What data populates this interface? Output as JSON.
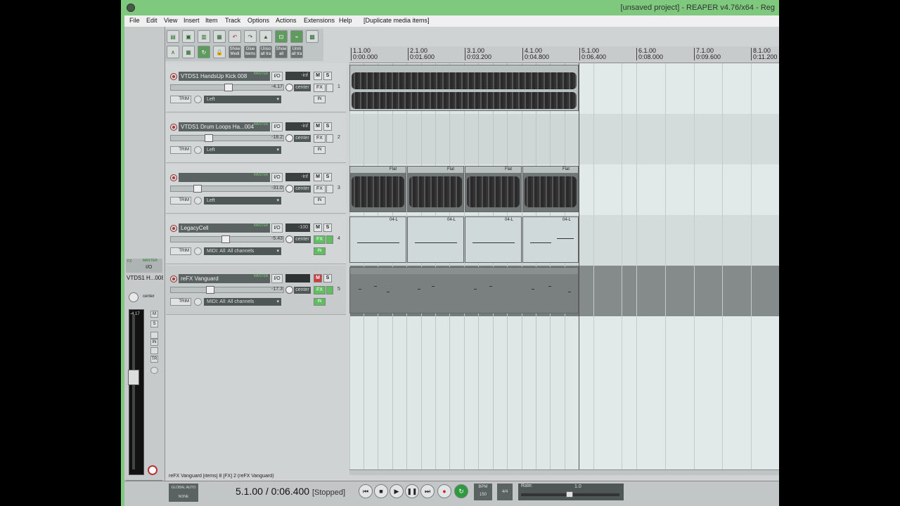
{
  "window": {
    "title": "[unsaved project] - REAPER v4.76/x64 - Reg"
  },
  "menu": {
    "items": [
      "File",
      "Edit",
      "View",
      "Insert",
      "Item",
      "Track",
      "Options",
      "Actions",
      "Extensions",
      "Help"
    ],
    "last_action": "[Duplicate media items]"
  },
  "toolbar": {
    "show_media": "Show Medi",
    "glue_items": "Glue items",
    "unsolo_all": "Unso all tra",
    "show_all": "Show all",
    "unmute_all": "Unm all tra"
  },
  "ruler": {
    "marks": [
      {
        "bar": "1.1.00",
        "time": "0:00.000"
      },
      {
        "bar": "2.1.00",
        "time": "0:01.600"
      },
      {
        "bar": "3.1.00",
        "time": "0:03.200"
      },
      {
        "bar": "4.1.00",
        "time": "0:04.800"
      },
      {
        "bar": "5.1.00",
        "time": "0:06.400"
      },
      {
        "bar": "6.1.00",
        "time": "0:08.000"
      },
      {
        "bar": "7.1.00",
        "time": "0:09.600"
      },
      {
        "bar": "8.1.00",
        "time": "0:11.200"
      }
    ]
  },
  "tracks": [
    {
      "name": "VTDS1 HandsUp Kick 008",
      "master": "MASTER",
      "io": "I/O",
      "vol_readout": "-inf",
      "mute": "M",
      "solo": "S",
      "volume": "-4.17",
      "pan": "center",
      "fx": "FX",
      "trim": "TRIM",
      "input": "Left",
      "in": "IN",
      "number": "1"
    },
    {
      "name": "VTDS1 Drum Loops Ha...004",
      "master": "MASTER",
      "io": "I/O",
      "vol_readout": "-inf",
      "mute": "M",
      "solo": "S",
      "volume": "-18.2",
      "pan": "center",
      "fx": "FX",
      "trim": "TRIM",
      "input": "Left",
      "in": "IN",
      "number": "2"
    },
    {
      "name": "",
      "master": "MASTER",
      "io": "I/O",
      "vol_readout": "-inf",
      "mute": "M",
      "solo": "S",
      "volume": "-31.0",
      "pan": "center",
      "fx": "FX",
      "trim": "TRIM",
      "input": "Left",
      "in": "IN",
      "number": "3"
    },
    {
      "name": "LegacyCell",
      "master": "MASTER",
      "io": "I/O",
      "vol_readout": "-100",
      "mute": "M",
      "solo": "S",
      "volume": "-5.43",
      "pan": "center",
      "fx": "FX",
      "trim": "TRIM",
      "input": "MIDI: All: All channels",
      "in": "IN",
      "number": "4"
    },
    {
      "name": "reFX Vanguard",
      "master": "MASTER",
      "io": "I/O",
      "vol_readout": "",
      "mute": "M",
      "solo": "S",
      "volume": "-17.3",
      "pan": "center",
      "fx": "FX",
      "trim": "TRIM",
      "input": "MIDI: All: All channels",
      "in": "IN",
      "number": "5"
    }
  ],
  "items": {
    "track3_label": "Flat",
    "track4_label": "04-L"
  },
  "mixer": {
    "master": "MASTER",
    "io": "I/O",
    "fx": "FX",
    "label": "VTDS1 H...008",
    "pan": "center",
    "volume": "-4.17",
    "mute": "M",
    "solo": "S",
    "in": "IN",
    "trim": "TR",
    "number": "1"
  },
  "status": {
    "text": "reFX Vanguard [items] 8 [FX] 2 (reFX Vanguard)"
  },
  "transport": {
    "global_auto": "GLOBAL AUTO",
    "none": "NONE",
    "time": "5.1.00 / 0:06.400",
    "state": "[Stopped]",
    "bpm_label": "BPM",
    "bpm": "150",
    "timesig": "4/4",
    "rate_label": "Rate:",
    "rate": "1.0"
  }
}
